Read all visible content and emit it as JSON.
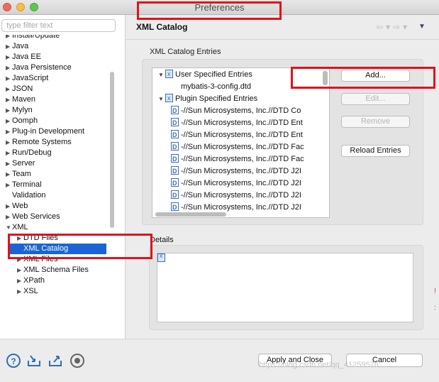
{
  "window": {
    "title": "Preferences"
  },
  "filter": {
    "placeholder": "type filter text"
  },
  "tree": [
    {
      "label": "Install/Update",
      "arrow": "▶"
    },
    {
      "label": "Java",
      "arrow": "▶"
    },
    {
      "label": "Java EE",
      "arrow": "▶"
    },
    {
      "label": "Java Persistence",
      "arrow": "▶"
    },
    {
      "label": "JavaScript",
      "arrow": "▶"
    },
    {
      "label": "JSON",
      "arrow": "▶"
    },
    {
      "label": "Maven",
      "arrow": "▶"
    },
    {
      "label": "Mylyn",
      "arrow": "▶"
    },
    {
      "label": "Oomph",
      "arrow": "▶"
    },
    {
      "label": "Plug-in Development",
      "arrow": "▶"
    },
    {
      "label": "Remote Systems",
      "arrow": "▶"
    },
    {
      "label": "Run/Debug",
      "arrow": "▶"
    },
    {
      "label": "Server",
      "arrow": "▶"
    },
    {
      "label": "Team",
      "arrow": "▶"
    },
    {
      "label": "Terminal",
      "arrow": "▶"
    },
    {
      "label": "Validation",
      "arrow": ""
    },
    {
      "label": "Web",
      "arrow": "▶"
    },
    {
      "label": "Web Services",
      "arrow": "▶"
    },
    {
      "label": "XML",
      "arrow": "▼"
    },
    {
      "label": "DTD Files",
      "arrow": "▶",
      "child": true
    },
    {
      "label": "XML Catalog",
      "arrow": "",
      "child": true,
      "selected": true
    },
    {
      "label": "XML Files",
      "arrow": "▶",
      "child": true
    },
    {
      "label": "XML Schema Files",
      "arrow": "▶",
      "child": true
    },
    {
      "label": "XPath",
      "arrow": "▶",
      "child": true
    },
    {
      "label": "XSL",
      "arrow": "▶",
      "child": true
    }
  ],
  "page": {
    "title": "XML Catalog",
    "entries_label": "XML Catalog Entries",
    "details_label": "Details"
  },
  "entries": [
    {
      "label": "User Specified Entries",
      "arrow": "▼",
      "icon": "catalog-icon",
      "level": 0
    },
    {
      "label": "mybatis-3-config.dtd",
      "arrow": "",
      "icon": "",
      "level": 1
    },
    {
      "label": "Plugin Specified Entries",
      "arrow": "▼",
      "icon": "catalog-icon",
      "level": 0
    },
    {
      "label": "-//Sun Microsystems, Inc.//DTD Co",
      "arrow": "",
      "icon": "dtd-icon",
      "level": 1
    },
    {
      "label": "-//Sun Microsystems, Inc.//DTD Ent",
      "arrow": "",
      "icon": "dtd-icon",
      "level": 1
    },
    {
      "label": "-//Sun Microsystems, Inc.//DTD Ent",
      "arrow": "",
      "icon": "dtd-icon",
      "level": 1
    },
    {
      "label": "-//Sun Microsystems, Inc.//DTD Fac",
      "arrow": "",
      "icon": "dtd-icon",
      "level": 1
    },
    {
      "label": "-//Sun Microsystems, Inc.//DTD Fac",
      "arrow": "",
      "icon": "dtd-icon",
      "level": 1
    },
    {
      "label": "-//Sun Microsystems, Inc.//DTD J2I",
      "arrow": "",
      "icon": "dtd-icon",
      "level": 1
    },
    {
      "label": "-//Sun Microsystems, Inc.//DTD J2I",
      "arrow": "",
      "icon": "dtd-icon",
      "level": 1
    },
    {
      "label": "-//Sun Microsystems, Inc.//DTD J2I",
      "arrow": "",
      "icon": "dtd-icon",
      "level": 1
    },
    {
      "label": "-//Sun Microsystems, Inc.//DTD J2I",
      "arrow": "",
      "icon": "dtd-icon",
      "level": 1
    }
  ],
  "buttons": {
    "add": "Add...",
    "edit": "Edit...",
    "remove": "Remove",
    "reload": "Reload Entries",
    "apply_close": "Apply and Close",
    "cancel": "Cancel"
  },
  "icons": {
    "nav_back": "back-arrow-icon",
    "nav_forward": "forward-arrow-icon",
    "view_menu": "view-menu-icon",
    "help": "help-icon",
    "import": "import-icon",
    "export": "export-icon",
    "record": "record-icon"
  },
  "watermark": "https://blog.csdn.net/qq_41259576",
  "colors": {
    "highlight_red": "#e0121b",
    "selection_blue": "#1b64d6"
  }
}
